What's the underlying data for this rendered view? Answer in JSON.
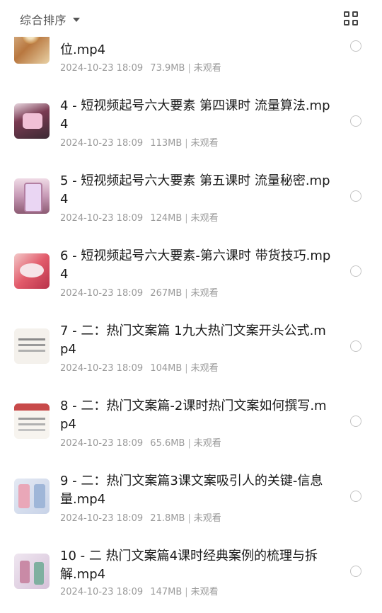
{
  "header": {
    "sort_label": "综合排序",
    "sort_icon": "caret-down-icon",
    "view_icon": "grid-view-icon"
  },
  "items": [
    {
      "title": "位.mp4",
      "date": "2024-10-23 18:09",
      "size": "73.9MB",
      "status": "未观看",
      "thumb": "t-food"
    },
    {
      "title": "4 - 短视频起号六大要素 第四课时 流量算法.mp4",
      "date": "2024-10-23 18:09",
      "size": "113MB",
      "status": "未观看",
      "thumb": "t-pink1"
    },
    {
      "title": "5 - 短视频起号六大要素 第五课时 流量秘密.mp4",
      "date": "2024-10-23 18:09",
      "size": "124MB",
      "status": "未观看",
      "thumb": "t-pink2"
    },
    {
      "title": "6 - 短视频起号六大要素-第六课时 带货技巧.mp4",
      "date": "2024-10-23 18:09",
      "size": "267MB",
      "status": "未观看",
      "thumb": "t-red"
    },
    {
      "title": "7 - 二：热门文案篇 1九大热门文案开头公式.mp4",
      "date": "2024-10-23 18:09",
      "size": "104MB",
      "status": "未观看",
      "thumb": "t-paper"
    },
    {
      "title": "8 - 二：热门文案篇-2课时热门文案如何撰写.mp4",
      "date": "2024-10-23 18:09",
      "size": "65.6MB",
      "status": "未观看",
      "thumb": "t-paper2"
    },
    {
      "title": "9 - 二：热门文案篇3课文案吸引人的关键-信息量.mp4",
      "date": "2024-10-23 18:09",
      "size": "21.8MB",
      "status": "未观看",
      "thumb": "t-people"
    },
    {
      "title": "10 - 二 热门文案篇4课时经典案例的梳理与拆解.mp4",
      "date": "2024-10-23 18:09",
      "size": "147MB",
      "status": "未观看",
      "thumb": "t-people2"
    }
  ]
}
